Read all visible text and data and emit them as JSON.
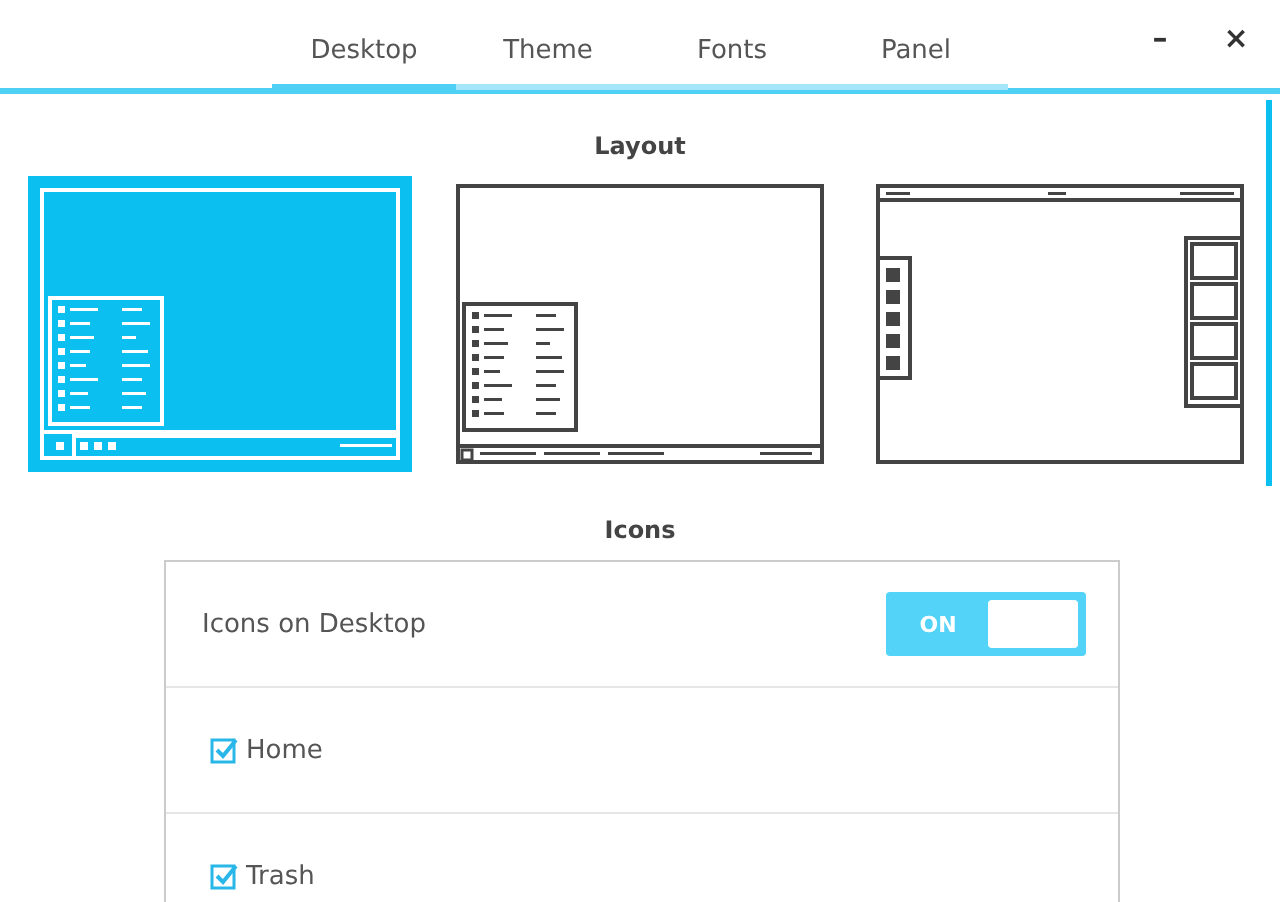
{
  "tabs": [
    {
      "label": "Desktop",
      "selected": true
    },
    {
      "label": "Theme",
      "selected": false
    },
    {
      "label": "Fonts",
      "selected": false
    },
    {
      "label": "Panel",
      "selected": false
    }
  ],
  "window_controls": [
    "–",
    "×"
  ],
  "layout": {
    "title": "Layout",
    "options": [
      {
        "kind": "classic",
        "selected": true
      },
      {
        "kind": "bottom-bar",
        "selected": false
      },
      {
        "kind": "top-bar-docks",
        "selected": false
      }
    ]
  },
  "icons": {
    "title": "Icons",
    "toggle": {
      "label": "Icons on Desktop",
      "on": true,
      "text": "ON"
    },
    "items": [
      {
        "label": "Home",
        "checked": true
      },
      {
        "label": "Trash",
        "checked": true
      }
    ]
  }
}
